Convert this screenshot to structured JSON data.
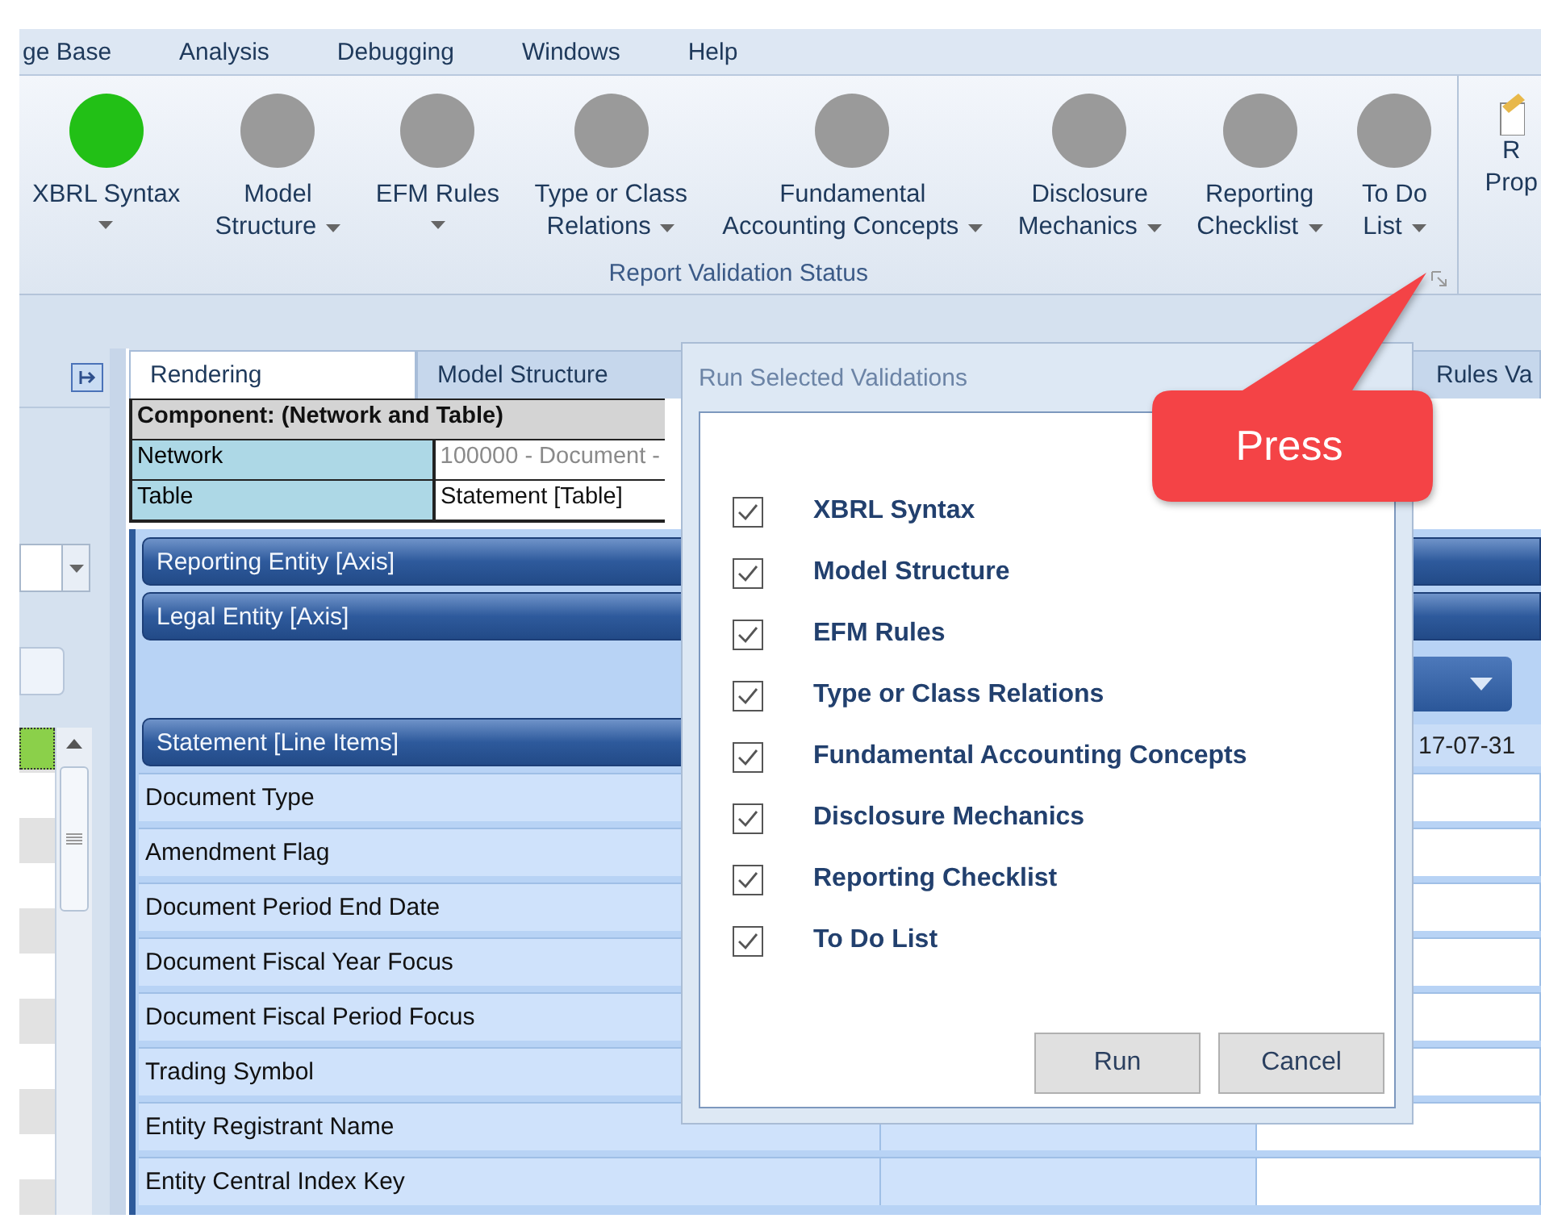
{
  "menu": [
    "ge Base",
    "Analysis",
    "Debugging",
    "Windows",
    "Help"
  ],
  "ribbon": {
    "buttons": [
      {
        "lines": [
          "XBRL Syntax"
        ],
        "color": "#22c016"
      },
      {
        "lines": [
          "Model",
          "Structure"
        ],
        "color": "#9a9a9a"
      },
      {
        "lines": [
          "EFM Rules"
        ],
        "color": "#9a9a9a"
      },
      {
        "lines": [
          "Type or Class",
          "Relations"
        ],
        "color": "#9a9a9a"
      },
      {
        "lines": [
          "Fundamental",
          "Accounting Concepts"
        ],
        "color": "#9a9a9a"
      },
      {
        "lines": [
          "Disclosure",
          "Mechanics"
        ],
        "color": "#9a9a9a"
      },
      {
        "lines": [
          "Reporting",
          "Checklist"
        ],
        "color": "#9a9a9a"
      },
      {
        "lines": [
          "To Do",
          "List"
        ],
        "color": "#9a9a9a"
      }
    ],
    "group_label": "Report Validation Status",
    "partial_button": {
      "lines": [
        "R",
        "Prop"
      ]
    }
  },
  "tabs": [
    {
      "label": "Rendering",
      "selected": true
    },
    {
      "label": "Model Structure",
      "selected": false
    },
    {
      "label": "Rules Va",
      "selected": false
    }
  ],
  "component": {
    "title": "Component: (Network and Table)",
    "rows": [
      {
        "label": "Network",
        "value": "100000 - Document -",
        "disabled": true
      },
      {
        "label": "Table",
        "value": "Statement [Table]",
        "disabled": false
      }
    ]
  },
  "axes": [
    "Reporting Entity [Axis]",
    "Legal Entity [Axis]"
  ],
  "line_items": {
    "title": "Statement [Line Items]",
    "date": "17-07-31",
    "rows": [
      "Document Type",
      "Amendment Flag",
      "Document Period End Date",
      "Document Fiscal Year Focus",
      "Document Fiscal Period Focus",
      "Trading Symbol",
      "Entity Registrant Name",
      "Entity Central Index Key"
    ]
  },
  "dialog": {
    "title": "Run Selected Validations",
    "validations": [
      {
        "label": "XBRL Syntax",
        "checked": true
      },
      {
        "label": "Model Structure",
        "checked": true
      },
      {
        "label": "EFM Rules",
        "checked": true
      },
      {
        "label": "Type or Class Relations",
        "checked": true
      },
      {
        "label": "Fundamental Accounting Concepts",
        "checked": true
      },
      {
        "label": "Disclosure Mechanics",
        "checked": true
      },
      {
        "label": "Reporting Checklist",
        "checked": true
      },
      {
        "label": "To Do List",
        "checked": true
      }
    ],
    "buttons": [
      "Run",
      "Cancel"
    ]
  },
  "callout": {
    "text": "Press"
  }
}
